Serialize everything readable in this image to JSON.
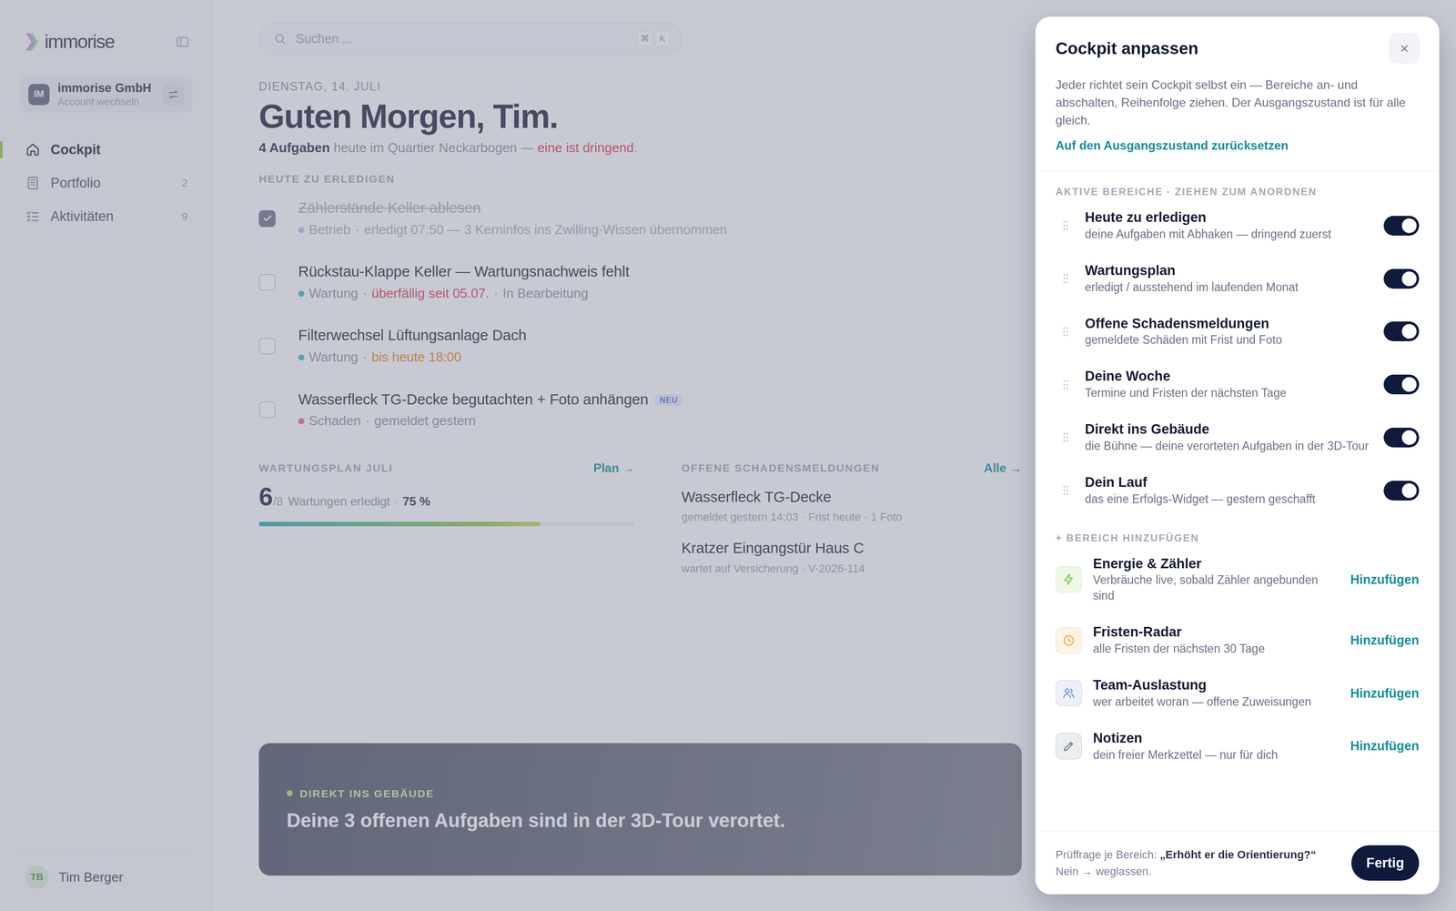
{
  "sidebar": {
    "logo": "immorise",
    "account": {
      "initials": "IM",
      "name": "immorise GmbH",
      "action": "Account wechseln"
    },
    "items": [
      {
        "label": "Cockpit",
        "selected": true
      },
      {
        "label": "Portfolio",
        "count": "2",
        "selected": false
      },
      {
        "label": "Aktivitäten",
        "count": "9",
        "selected": false
      }
    ],
    "user": {
      "initials": "TB",
      "name": "Tim Berger"
    }
  },
  "search": {
    "placeholder": "Suchen ...",
    "keys": [
      "⌘",
      "K"
    ]
  },
  "greeting": {
    "date": "DIENSTAG, 14. JULI",
    "title": "Guten Morgen, Tim.",
    "summary": [
      {
        "text": "4 Aufgaben",
        "kind": "strong"
      },
      {
        "text": " heute im Quartier Neckarbogen — ",
        "kind": "muted"
      },
      {
        "text": "eine ist dringend",
        "kind": "danger"
      },
      {
        "text": ".",
        "kind": "muted"
      }
    ]
  },
  "today": {
    "title": "HEUTE ZU ERLEDIGEN",
    "tasks": [
      {
        "title": "Zählerstände Keller ablesen",
        "checked": true,
        "color": "#8ea6e6",
        "meta": [
          {
            "text": "Betrieb",
            "kind": "muted"
          },
          {
            "text": "·",
            "kind": "muted"
          },
          {
            "text": "erledigt 07:50 — 3 Kerninfos ins Zwilling-Wissen übernommen",
            "kind": "muted"
          }
        ]
      },
      {
        "title": "Rückstau-Klappe Keller — Wartungsnachweis fehlt",
        "checked": false,
        "color": "#3fb4c4",
        "meta": [
          {
            "text": "Wartung",
            "kind": "muted"
          },
          {
            "text": "·",
            "kind": "muted"
          },
          {
            "text": "überfällig seit 05.07.",
            "kind": "danger"
          },
          {
            "text": "·",
            "kind": "muted"
          },
          {
            "text": "In Bearbeitung",
            "kind": "muted"
          }
        ]
      },
      {
        "title": "Filterwechsel Lüftungsanlage Dach",
        "checked": false,
        "color": "#3fb4c4",
        "meta": [
          {
            "text": "Wartung",
            "kind": "muted"
          },
          {
            "text": "·",
            "kind": "muted"
          },
          {
            "text": "bis heute 18:00",
            "kind": "warning"
          }
        ]
      },
      {
        "title": "Wasserfleck TG-Decke begutachten + Foto anhängen",
        "badge": "NEU",
        "checked": false,
        "color": "#e0609a",
        "meta": [
          {
            "text": "Schaden",
            "kind": "muted"
          },
          {
            "text": "·",
            "kind": "muted"
          },
          {
            "text": "gemeldet gestern",
            "kind": "muted"
          }
        ]
      }
    ]
  },
  "maintenance": {
    "title": "WARTUNGSPLAN JULI",
    "link": "Plan →",
    "done": "6",
    "total": "/8",
    "label": "Wartungen erledigt ·",
    "percent": "75 %",
    "level": 0.75
  },
  "damages": {
    "title": "OFFENE SCHADENSMELDUNGEN",
    "link": "Alle →",
    "items": [
      {
        "title": "Wasserfleck TG-Decke",
        "detail": "gemeldet gestern 14:03 · Frist heute · 1 Foto"
      },
      {
        "title": "Kratzer Eingangstür Haus C",
        "detail": "wartet auf Versicherung · V-2026-114"
      }
    ]
  },
  "banner": {
    "label": "DIREKT INS GEBÄUDE",
    "text": "Deine 3 offenen Aufgaben sind in der 3D-Tour verortet."
  },
  "drawer": {
    "title": "Cockpit anpassen",
    "description": "Jeder richtet sein Cockpit selbst ein — Bereiche an- und abschalten, Reihenfolge ziehen. Der Ausgangszustand ist für alle gleich.",
    "reset": "Auf den Ausgangszustand zurücksetzen",
    "active_title": "AKTIVE BEREICHE · ZIEHEN ZUM ANORDNEN",
    "active": [
      {
        "title": "Heute zu erledigen",
        "subtitle": "deine Aufgaben mit Abhaken — dringend zuerst",
        "on": true
      },
      {
        "title": "Wartungsplan",
        "subtitle": "erledigt / ausstehend im laufenden Monat",
        "on": true
      },
      {
        "title": "Offene Schadensmeldungen",
        "subtitle": "gemeldete Schäden mit Frist und Foto",
        "on": true
      },
      {
        "title": "Deine Woche",
        "subtitle": "Termine und Fristen der nächsten Tage",
        "on": true
      },
      {
        "title": "Direkt ins Gebäude",
        "subtitle": "die Bühne — deine verorteten Aufgaben in der 3D-Tour",
        "on": true
      },
      {
        "title": "Dein Lauf",
        "subtitle": "das eine Erfolgs-Widget — gestern geschafft",
        "on": true
      }
    ],
    "add_title": "+ BEREICH HINZUFÜGEN",
    "available": [
      {
        "title": "Energie & Zähler",
        "subtitle": "Verbräuche live, sobald Zähler angebunden sind",
        "action": "Hinzufügen",
        "color": "#7cc242"
      },
      {
        "title": "Fristen-Radar",
        "subtitle": "alle Fristen der nächsten 30 Tage",
        "action": "Hinzufügen",
        "color": "#f0a030"
      },
      {
        "title": "Team-Auslastung",
        "subtitle": "wer arbeitet woran — offene Zuweisungen",
        "action": "Hinzufügen",
        "color": "#6b86c9"
      },
      {
        "title": "Notizen",
        "subtitle": "dein freier Merkzettel — nur für dich",
        "action": "Hinzufügen",
        "color": "#6b7185"
      }
    ],
    "footer": {
      "note_label": "Prüffrage je Bereich: ",
      "note_question": "„Erhöht er die Orientierung?“",
      "note_rest": "Nein → weglassen.",
      "button": "Fertig"
    }
  }
}
